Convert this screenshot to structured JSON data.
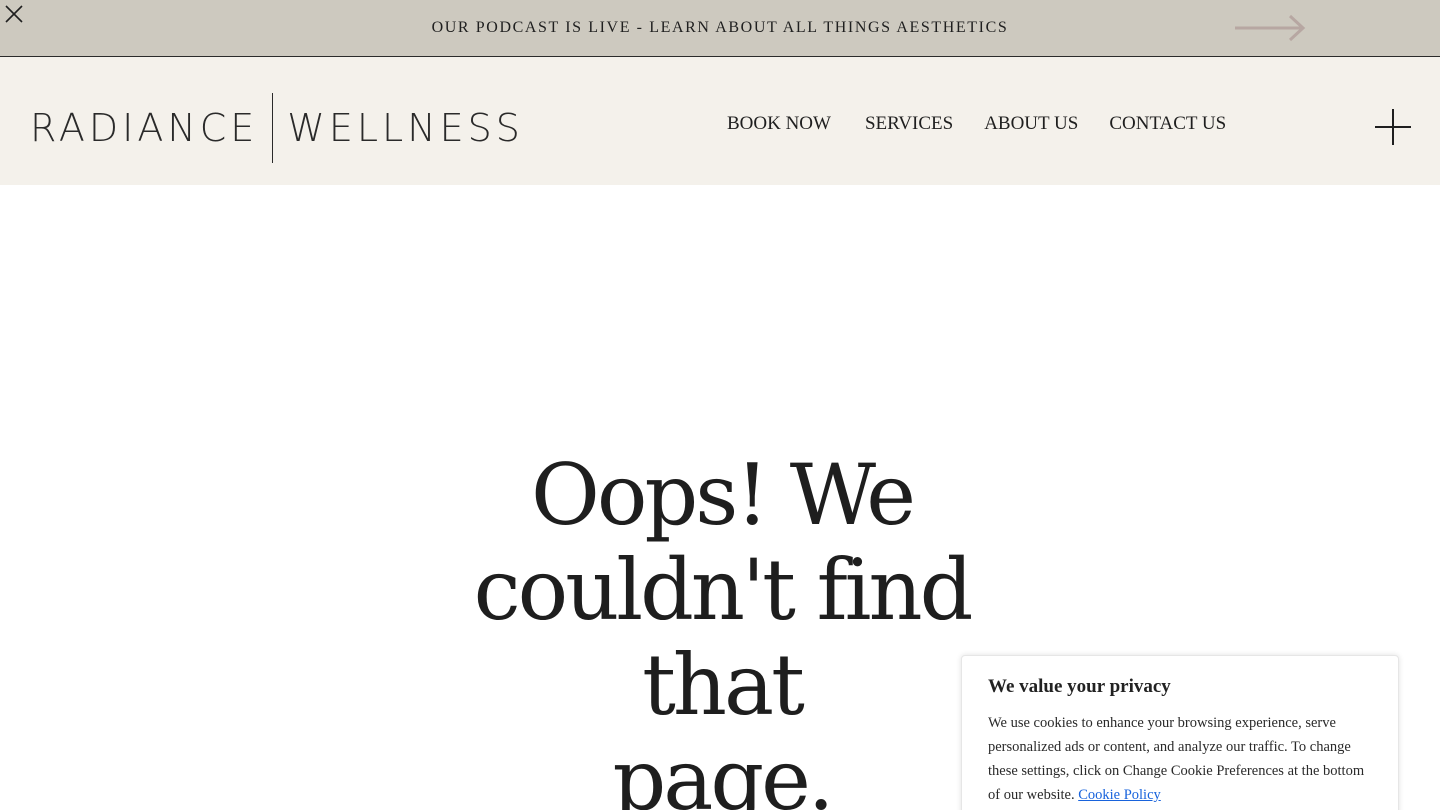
{
  "announcement": {
    "text": "OUR PODCAST IS LIVE - LEARN ABOUT ALL THINGS AESTHETICS",
    "close_icon": "close-icon",
    "arrow_icon": "arrow-right-icon"
  },
  "header": {
    "logo": {
      "left": "RADIANCE",
      "right": "WELLNESS"
    },
    "nav": [
      {
        "label": "BOOK NOW"
      },
      {
        "label": "SERVICES"
      },
      {
        "label": "ABOUT US"
      },
      {
        "label": "CONTACT US"
      }
    ],
    "menu_icon": "plus-icon"
  },
  "main": {
    "heading_line1": "Oops! We",
    "heading_line2": "couldn't find that",
    "heading_line3": "page."
  },
  "cookie_banner": {
    "title": "We value your privacy",
    "body": "We use cookies to enhance your browsing experience, serve personalized ads or content, and analyze our traffic. To change these settings, click on Change Cookie Preferences at the bottom of our website.",
    "link": "Cookie Policy"
  },
  "colors": {
    "announcement_bg": "#cdc9bf",
    "header_bg": "#f4f1eb",
    "arrow": "#b7a7a2",
    "link": "#1863dc"
  }
}
